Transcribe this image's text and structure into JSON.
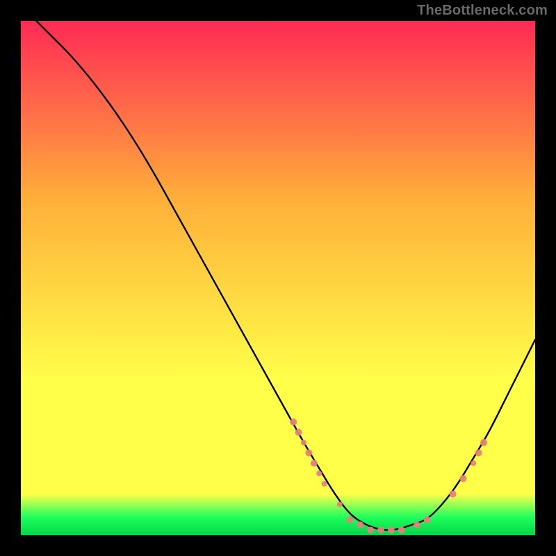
{
  "watermark": "TheBottleneck.com",
  "colors": {
    "gradient_top": "#ff2a55",
    "gradient_mid_upper": "#ffb03a",
    "gradient_mid_lower": "#ffff4a",
    "gradient_green": "#1fff5c",
    "gradient_bottom": "#00d84a",
    "curve": "#000000",
    "marker_fill": "#e77f7b",
    "marker_stroke": "#e77f7b"
  },
  "chart_data": {
    "type": "line",
    "title": "",
    "xlabel": "",
    "ylabel": "",
    "xlim": [
      0,
      100
    ],
    "ylim": [
      0,
      100
    ],
    "grid": false,
    "legend": false,
    "curve": [
      {
        "x": 3,
        "y": 100
      },
      {
        "x": 6,
        "y": 97
      },
      {
        "x": 10,
        "y": 93
      },
      {
        "x": 15,
        "y": 87
      },
      {
        "x": 20,
        "y": 80
      },
      {
        "x": 25,
        "y": 72
      },
      {
        "x": 30,
        "y": 63
      },
      {
        "x": 35,
        "y": 54
      },
      {
        "x": 40,
        "y": 45
      },
      {
        "x": 45,
        "y": 36
      },
      {
        "x": 50,
        "y": 27
      },
      {
        "x": 55,
        "y": 18
      },
      {
        "x": 58,
        "y": 13
      },
      {
        "x": 61,
        "y": 8
      },
      {
        "x": 64,
        "y": 4
      },
      {
        "x": 67,
        "y": 2
      },
      {
        "x": 70,
        "y": 1
      },
      {
        "x": 73,
        "y": 1
      },
      {
        "x": 76,
        "y": 2
      },
      {
        "x": 79,
        "y": 3
      },
      {
        "x": 82,
        "y": 6
      },
      {
        "x": 85,
        "y": 10
      },
      {
        "x": 88,
        "y": 15
      },
      {
        "x": 91,
        "y": 20
      },
      {
        "x": 94,
        "y": 26
      },
      {
        "x": 97,
        "y": 32
      },
      {
        "x": 100,
        "y": 38
      }
    ],
    "markers": [
      {
        "x": 53,
        "y": 22,
        "r": 5
      },
      {
        "x": 54,
        "y": 20,
        "r": 5
      },
      {
        "x": 55,
        "y": 18,
        "r": 4
      },
      {
        "x": 56,
        "y": 16,
        "r": 5
      },
      {
        "x": 57,
        "y": 14,
        "r": 5
      },
      {
        "x": 58,
        "y": 12,
        "r": 4
      },
      {
        "x": 59,
        "y": 10,
        "r": 4
      },
      {
        "x": 62,
        "y": 6,
        "r": 4
      },
      {
        "x": 64,
        "y": 3,
        "r": 5
      },
      {
        "x": 66,
        "y": 2,
        "r": 5
      },
      {
        "x": 68,
        "y": 1,
        "r": 5
      },
      {
        "x": 70,
        "y": 1,
        "r": 5
      },
      {
        "x": 72,
        "y": 1,
        "r": 5
      },
      {
        "x": 74,
        "y": 1,
        "r": 5
      },
      {
        "x": 77,
        "y": 2,
        "r": 5
      },
      {
        "x": 79,
        "y": 3,
        "r": 5
      },
      {
        "x": 84,
        "y": 8,
        "r": 5
      },
      {
        "x": 86,
        "y": 11,
        "r": 5
      },
      {
        "x": 88,
        "y": 14,
        "r": 4
      },
      {
        "x": 89,
        "y": 16,
        "r": 5
      },
      {
        "x": 90,
        "y": 18,
        "r": 5
      }
    ]
  }
}
